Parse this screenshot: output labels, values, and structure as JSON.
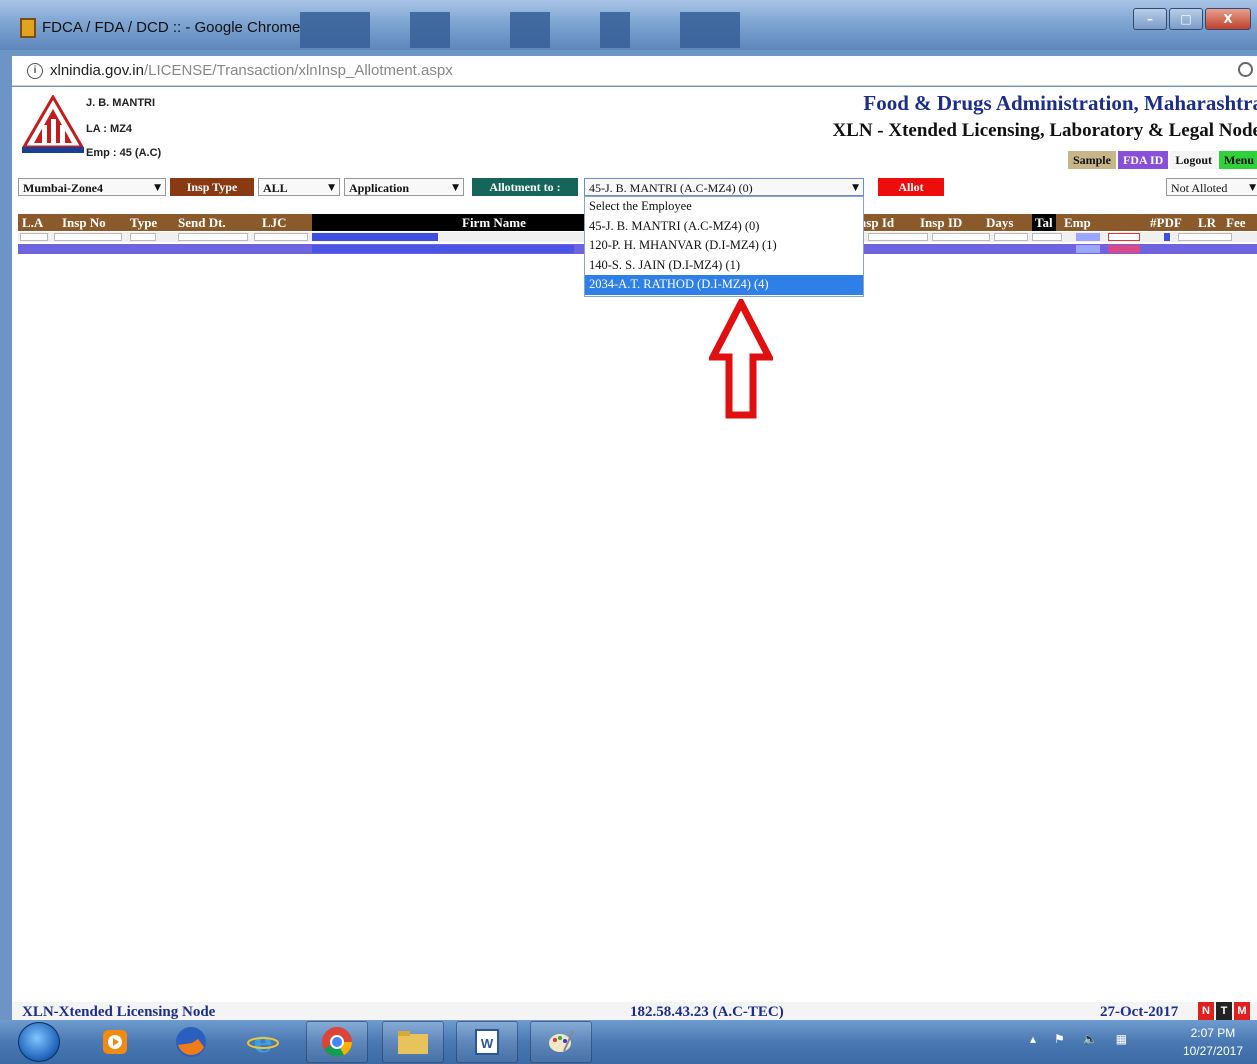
{
  "window": {
    "title": "FDCA / FDA / DCD :: - Google Chrome",
    "minimize": "–",
    "maximize": "□",
    "close": "X"
  },
  "address": {
    "host": "xlnindia.gov.in",
    "path": "/LICENSE/Transaction/xlnInsp_Allotment.aspx"
  },
  "user": {
    "name": "J. B. MANTRI",
    "la": "LA : MZ4",
    "emp": "Emp : 45 (A.C)"
  },
  "org": {
    "title": "Food & Drugs Administration, Maharashtra",
    "subtitle": "XLN - Xtended Licensing, Laboratory & Legal Node"
  },
  "header_buttons": {
    "sample": "Sample",
    "fda_id": "FDA ID",
    "logout": "Logout",
    "menu": "Menu"
  },
  "filters": {
    "zone": "Mumbai-Zone4",
    "insp_type_label": "Insp Type",
    "insp_type_value": "ALL",
    "category": "Application",
    "allotment_label": "Allotment to :",
    "allotment_value": "45-J. B. MANTRI (A.C-MZ4) (0)",
    "allot_button": "Allot",
    "status": "Not Alloted"
  },
  "dropdown": {
    "options": [
      "Select the Employee",
      "45-J. B. MANTRI (A.C-MZ4) (0)",
      "120-P. H. MHANVAR (D.I-MZ4) (1)",
      "140-S. S. JAIN (D.I-MZ4) (1)",
      "2034-A.T. RATHOD (D.I-MZ4) (4)"
    ],
    "highlighted_index": 4
  },
  "table": {
    "headers": {
      "la": "L.A",
      "insp_no": "Insp No",
      "type": "Type",
      "send_dt": "Send Dt.",
      "ljc": "LJC",
      "firm": "Firm Name",
      "insp_id": "Insp Id",
      "insp_id2": "Insp ID",
      "days": "Days",
      "tal": "Tal",
      "emp": "Emp",
      "pdf": "#PDF",
      "lr": "LR",
      "fee": "Fee"
    }
  },
  "footer": {
    "left": "XLN-Xtended Licensing Node",
    "center": "182.58.43.23 (A.C-TEC)",
    "right": "27-Oct-2017",
    "boxes": [
      "N",
      "T",
      "M"
    ]
  },
  "taskbar": {
    "time": "2:07 PM",
    "date": "10/27/2017"
  },
  "colors": {
    "org_title": "#1c2e8a",
    "table_header": "#8a5a2b",
    "selected_row": "#6f63de",
    "dropdown_highlight": "#2f7fe8",
    "annotation_arrow": "#e01010"
  }
}
